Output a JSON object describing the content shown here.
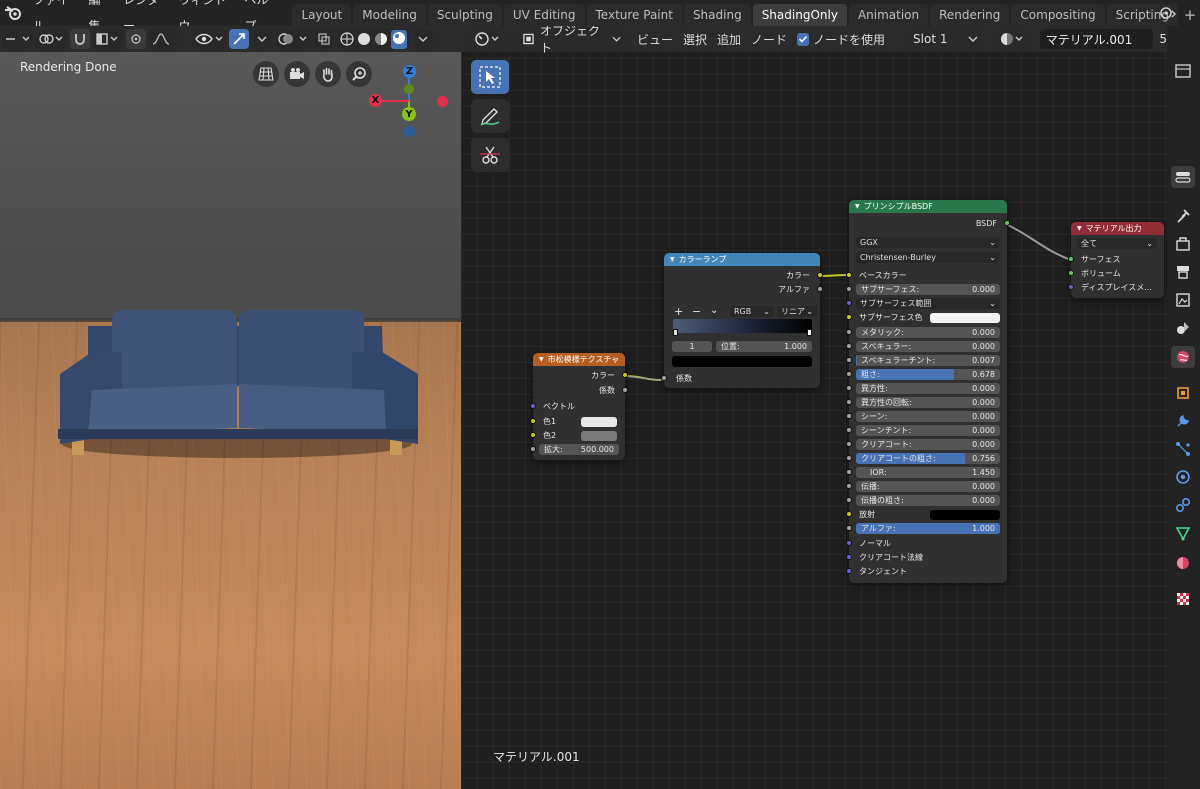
{
  "menubar": {
    "menus": [
      "ファイル",
      "編集",
      "レンダー",
      "ウィンドウ",
      "ヘルプ"
    ],
    "workspaces": [
      "Layout",
      "Modeling",
      "Sculpting",
      "UV Editing",
      "Texture Paint",
      "Shading",
      "ShadingOnly",
      "Animation",
      "Rendering",
      "Compositing",
      "Scripting"
    ],
    "active_workspace": "ShadingOnly",
    "add_tab": "+"
  },
  "viewport": {
    "status": "Rendering Done",
    "gizmo": {
      "z": "Z",
      "y": "Y",
      "x": "X"
    },
    "colors": {
      "wall": "#4f4f4f",
      "floor": "#b98157",
      "sofa": "#3a4e72",
      "x_axis": "#e0324b",
      "y_axis": "#8bc21a",
      "z_axis": "#2f7fe0"
    }
  },
  "node_editor": {
    "header": {
      "mode": "オブジェクト",
      "menus": [
        "ビュー",
        "選択",
        "追加",
        "ノード"
      ],
      "use_nodes_label": "ノードを使用",
      "slot": "Slot 1",
      "material_name": "マテリアル.001",
      "user_count": "5"
    },
    "material_label": "マテリアル.001",
    "checker_node": {
      "title": "市松模様テクスチャ",
      "outputs": [
        "カラー",
        "係数"
      ],
      "inputs": {
        "vector": "ベクトル",
        "color1": "色1",
        "color2": "色2",
        "scale_label": "拡大:",
        "scale_value": "500.000"
      }
    },
    "colorramp_node": {
      "title": "カラーランプ",
      "outputs": [
        "カラー",
        "アルファ"
      ],
      "controls": {
        "add": "+",
        "remove": "−",
        "menu": "⌄",
        "color_mode": "RGB",
        "interpolation": "リニア"
      },
      "stop_index": "1",
      "position_label": "位置:",
      "position_value": "1.000",
      "input": "係数"
    },
    "bsdf_node": {
      "title": "プリンシプルBSDF",
      "output": "BSDF",
      "distribution": "GGX",
      "subsurface_method": "Christensen-Burley",
      "base_color": "ベースカラー",
      "subsurface_range": "サブサーフェス範囲",
      "subsurface_color": "サブサーフェス色",
      "emission": "放射",
      "normal": "ノーマル",
      "clearcoat_normal": "クリアコート法線",
      "tangent": "タンジェント",
      "params": [
        {
          "label": "サブサーフェス:",
          "value": "0.000",
          "fill": 0
        },
        {
          "label": "メタリック:",
          "value": "0.000",
          "fill": 0
        },
        {
          "label": "スペキュラー:",
          "value": "0.000",
          "fill": 0
        },
        {
          "label": "スペキュラーチント:",
          "value": "0.007",
          "fill": 0.007
        },
        {
          "label": "粗さ:",
          "value": "0.678",
          "fill": 0.678
        },
        {
          "label": "異方性:",
          "value": "0.000",
          "fill": 0
        },
        {
          "label": "異方性の回転:",
          "value": "0.000",
          "fill": 0
        },
        {
          "label": "シーン:",
          "value": "0.000",
          "fill": 0
        },
        {
          "label": "シーンチント:",
          "value": "0.000",
          "fill": 0
        },
        {
          "label": "クリアコート:",
          "value": "0.000",
          "fill": 0
        },
        {
          "label": "クリアコートの粗さ:",
          "value": "0.756",
          "fill": 0.756
        }
      ],
      "ior": {
        "label": "IOR:",
        "value": "1.450"
      },
      "transmission": {
        "label": "伝播:",
        "value": "0.000"
      },
      "transmission_roughness": {
        "label": "伝播の粗さ:",
        "value": "0.000"
      },
      "alpha": {
        "label": "アルファ:",
        "value": "1.000",
        "fill": 1
      }
    },
    "output_node": {
      "title": "マテリアル出力",
      "target": "全て",
      "inputs": [
        "サーフェス",
        "ボリューム",
        "ディスプレイスメ..."
      ]
    },
    "colors": {
      "bsdf_header": "#28784b",
      "output_header": "#912d36",
      "texture_header": "#b55e24",
      "ramp_header": "#4485b7"
    }
  }
}
